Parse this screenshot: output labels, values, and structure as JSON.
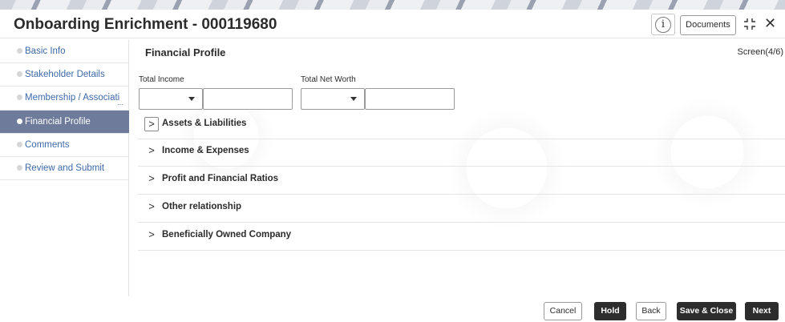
{
  "header": {
    "title": "Onboarding Enrichment - 000119680",
    "documents_label": "Documents",
    "info_icon_glyph": "i",
    "close_glyph": "✕"
  },
  "sidebar": {
    "items": [
      {
        "label": "Basic Info",
        "active": false
      },
      {
        "label": "Stakeholder Details",
        "active": false
      },
      {
        "label": "Membership / Associati",
        "active": false
      },
      {
        "label": "Financial Profile",
        "active": true
      },
      {
        "label": "Comments",
        "active": false
      },
      {
        "label": "Review and Submit",
        "active": false
      }
    ],
    "truncation": "..."
  },
  "main": {
    "section_title": "Financial Profile",
    "screen_counter": "Screen(4/6)",
    "fields": {
      "total_income_label": "Total Income",
      "total_income_value": "",
      "total_net_worth_label": "Total Net Worth",
      "total_net_worth_value": ""
    },
    "accordions": [
      {
        "label": "Assets & Liabilities",
        "chevron": ">"
      },
      {
        "label": "Income & Expenses",
        "chevron": ">"
      },
      {
        "label": "Profit and Financial Ratios",
        "chevron": ">"
      },
      {
        "label": "Other relationship",
        "chevron": ">"
      },
      {
        "label": "Beneficially Owned Company",
        "chevron": ">"
      }
    ]
  },
  "footer": {
    "cancel_label": "Cancel",
    "hold_label": "Hold",
    "back_label": "Back",
    "save_close_label": "Save & Close",
    "next_label": "Next"
  },
  "colors": {
    "active_nav_bg": "#6f7b9a",
    "link_color": "#3d6aa8",
    "dark_button": "#2d2d2d"
  }
}
